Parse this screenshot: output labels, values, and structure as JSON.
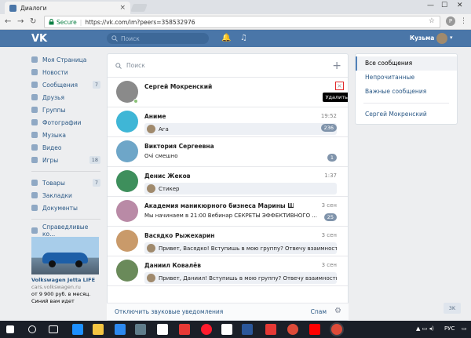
{
  "browser": {
    "tab_title": "Диалоги",
    "tab_close": "×",
    "secure_label": "Secure",
    "url": "https://vk.com/im?peers=358532976",
    "extension_letter": "P",
    "win_min": "—",
    "win_max": "☐",
    "win_close": "✕"
  },
  "header": {
    "logo": "VK",
    "search_placeholder": "Поиск",
    "user_name": "Кузьма"
  },
  "left_nav": {
    "items": [
      {
        "label": "Моя Страница",
        "count": ""
      },
      {
        "label": "Новости",
        "count": ""
      },
      {
        "label": "Сообщения",
        "count": "7"
      },
      {
        "label": "Друзья",
        "count": ""
      },
      {
        "label": "Группы",
        "count": ""
      },
      {
        "label": "Фотографии",
        "count": ""
      },
      {
        "label": "Музыка",
        "count": ""
      },
      {
        "label": "Видео",
        "count": ""
      },
      {
        "label": "Игры",
        "count": "18"
      }
    ],
    "items2": [
      {
        "label": "Товары",
        "count": "7"
      },
      {
        "label": "Закладки",
        "count": ""
      },
      {
        "label": "Документы",
        "count": ""
      }
    ],
    "items3": [
      {
        "label": "Справедливые ко...",
        "count": ""
      }
    ]
  },
  "ad": {
    "title": "Volkswagen Jetta LIFE",
    "site": "cars.volkswagen.ru",
    "text": "от 9 900 руб. в месяц. Синий вам идет"
  },
  "dialogs": {
    "search_placeholder": "Поиск",
    "delete_tooltip": "Удалить",
    "messages": [
      {
        "name": "Сергей Мокренский",
        "time": "",
        "text": "",
        "count": "",
        "color": "#8a8a8a",
        "online": true
      },
      {
        "name": "Аниме",
        "time": "19:52",
        "text": "Ага",
        "count": "236",
        "color": "#3fb6d6",
        "online": false
      },
      {
        "name": "Виктория Сергеевна",
        "time": "",
        "text": "Очі смешно",
        "count": "1",
        "color": "#6ea6c8",
        "online": false
      },
      {
        "name": "Денис Жеков",
        "time": "1:37",
        "text": "Стикер",
        "count": "",
        "color": "#3e8f5c",
        "online": false
      },
      {
        "name": "Академия маникюрного бизнеса Марины Щегло...",
        "time": "3 сен",
        "text": "Мы начинаем в 21:00 Вебинар СЕКРЕТЫ ЭФФЕКТИВНОГО ...",
        "count": "25",
        "color": "#b98aa6",
        "online": false
      },
      {
        "name": "Васядко Рыжехарин",
        "time": "3 сен",
        "text": "Привет, Васядко! Вступишь в мою группу? Отвечу взаимность...",
        "count": "",
        "color": "#c99a6a",
        "online": false
      },
      {
        "name": "Даниил Ковалёв",
        "time": "3 сен",
        "text": "Привет, Даниил! Вступишь в мою группу? Отвечу взаимность...",
        "count": "",
        "color": "#6a8a5a",
        "online": false
      }
    ],
    "footer_label": "Отключить звуковые уведомления",
    "spam_label": "Спам"
  },
  "right_menu": {
    "items": [
      "Все сообщения",
      "Непрочитанные",
      "Важные сообщения"
    ],
    "contact": "Сергей Мокренский"
  },
  "back_top": "3K",
  "taskbar": {
    "lang": "РУС"
  }
}
